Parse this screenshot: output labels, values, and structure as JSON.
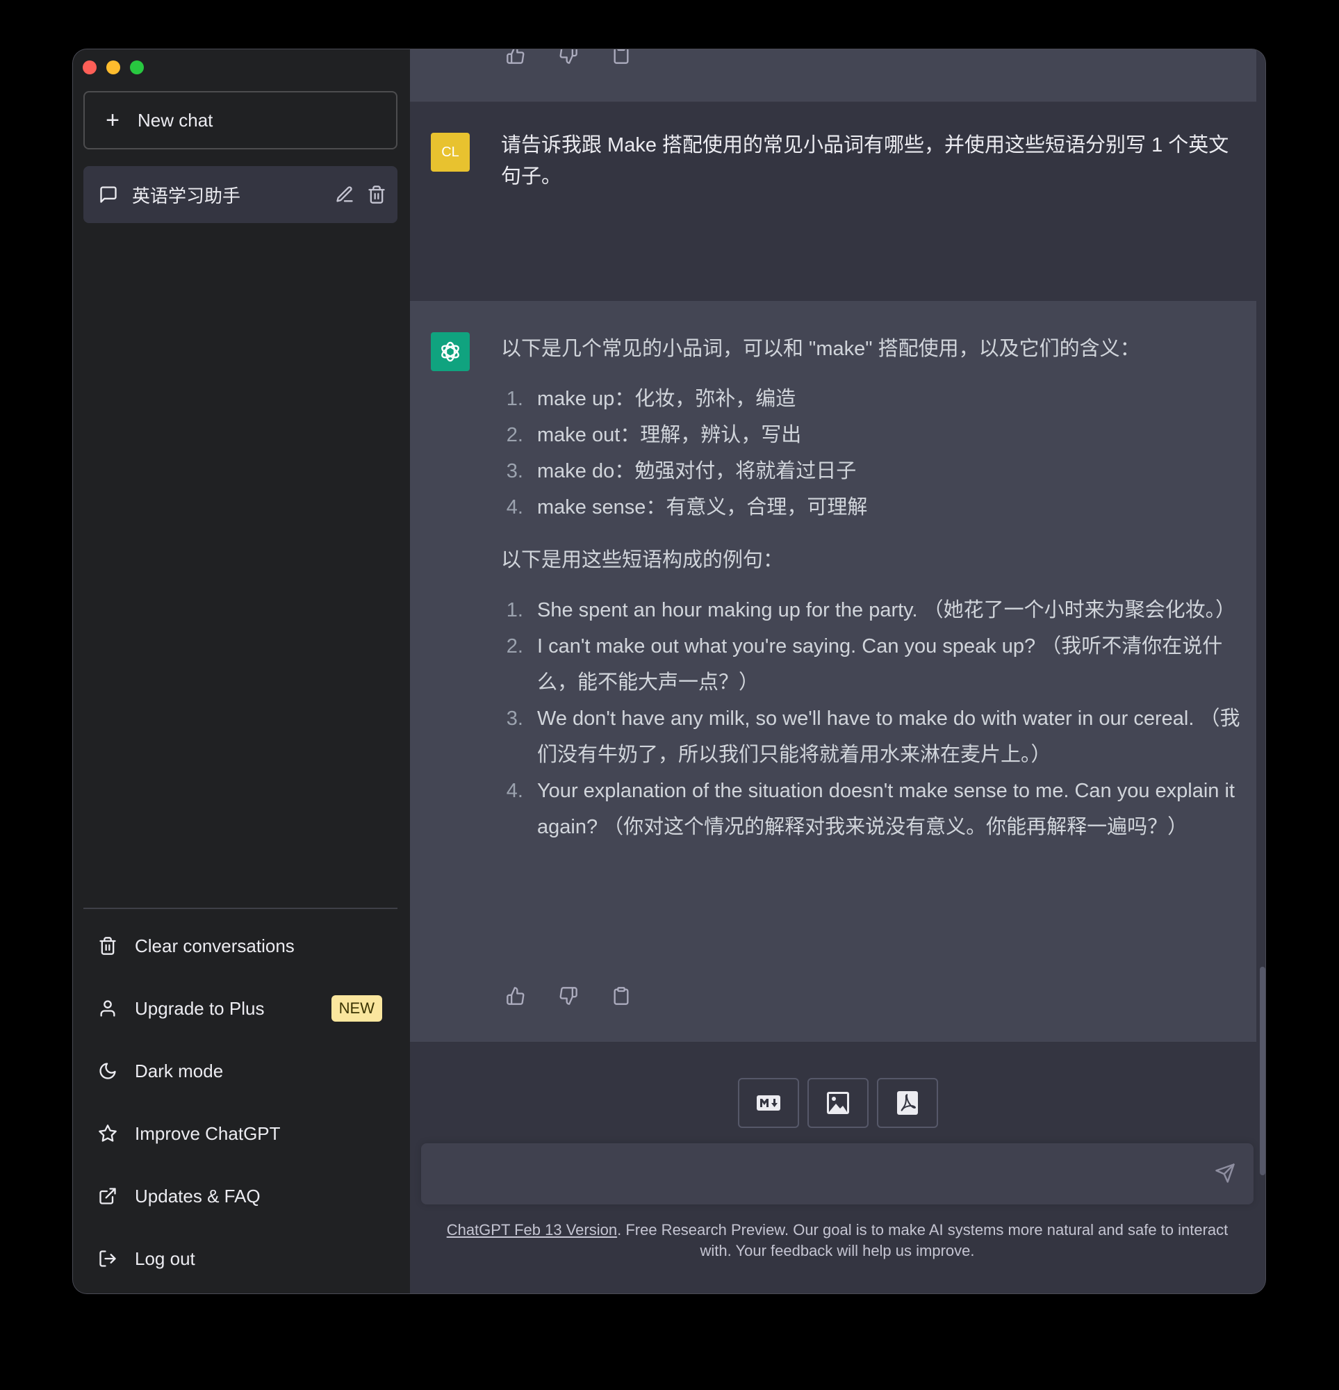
{
  "sidebar": {
    "new_chat_label": "New chat",
    "conversation_title": "英语学习助手",
    "menu": [
      {
        "label": "Clear conversations",
        "icon": "trash-icon"
      },
      {
        "label": "Upgrade to Plus",
        "icon": "user-icon",
        "badge": "NEW"
      },
      {
        "label": "Dark mode",
        "icon": "moon-icon"
      },
      {
        "label": "Improve ChatGPT",
        "icon": "star-icon"
      },
      {
        "label": "Updates & FAQ",
        "icon": "external-link-icon"
      },
      {
        "label": "Log out",
        "icon": "logout-icon"
      }
    ]
  },
  "chat": {
    "user": {
      "avatar": "CL",
      "message": "请告诉我跟 Make 搭配使用的常见小品词有哪些，并使用这些短语分别写 1 个英文句子。"
    },
    "assistant": {
      "intro": "以下是几个常见的小品词，可以和 \"make\" 搭配使用，以及它们的含义：",
      "phrases": [
        "make up：化妆，弥补，编造",
        "make out：理解，辨认，写出",
        "make do：勉强对付，将就着过日子",
        "make sense：有意义，合理，可理解"
      ],
      "examples_intro": "以下是用这些短语构成的例句：",
      "examples": [
        "She spent an hour making up for the party. （她花了一个小时来为聚会化妆。）",
        "I can't make out what you're saying. Can you speak up? （我听不清你在说什么，能不能大声一点？）",
        "We don't have any milk, so we'll have to make do with water in our cereal. （我们没有牛奶了，所以我们只能将就着用水来淋在麦片上。）",
        "Your explanation of the situation doesn't make sense to me. Can you explain it again? （你对这个情况的解释对我来说没有意义。你能再解释一遍吗？）"
      ]
    }
  },
  "toolbar": {
    "tools": [
      "markdown-icon",
      "image-icon",
      "pdf-icon"
    ]
  },
  "input": {
    "value": "",
    "send_icon": "send-icon"
  },
  "footer": {
    "link": "ChatGPT Feb 13 Version",
    "text": ". Free Research Preview. Our goal is to make AI systems more natural and safe to interact with. Your feedback will help us improve."
  },
  "colors": {
    "sidebar_bg": "#202123",
    "main_bg": "#343541",
    "assistant_bg": "#444654",
    "user_avatar": "#e8c22f",
    "assistant_avatar": "#10a37f",
    "badge_bg": "#fae69e"
  }
}
